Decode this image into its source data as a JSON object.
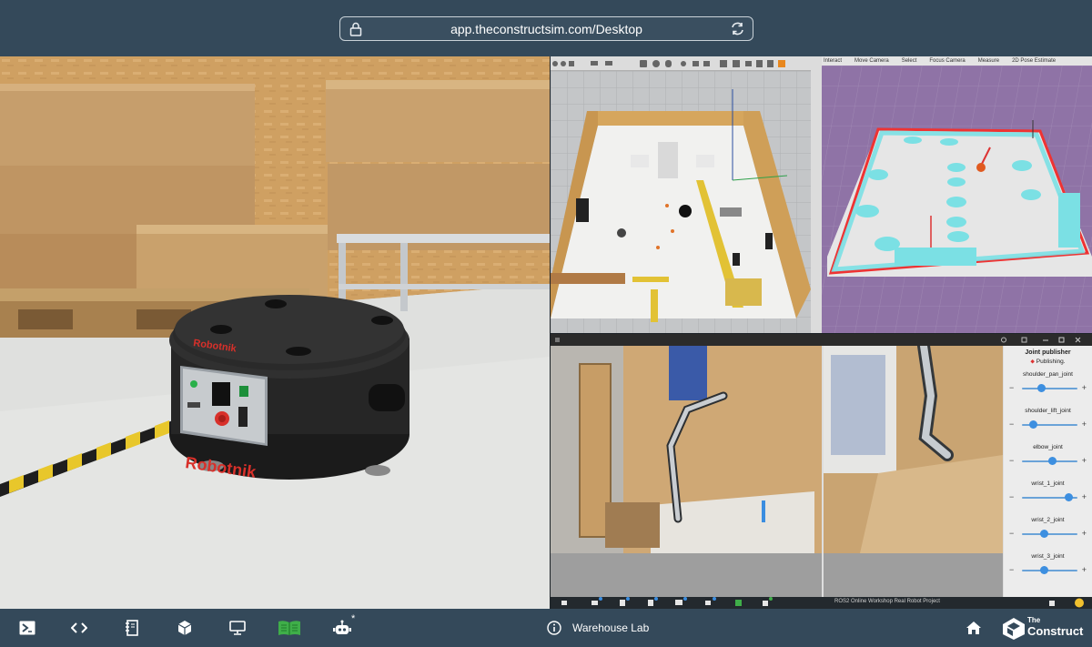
{
  "address_bar": {
    "url": "app.theconstructsim.com/Desktop",
    "lock_icon": "lock-icon",
    "reload_icon": "reload-icon"
  },
  "photo": {
    "robot_brand": "Robotnik",
    "robot_brand_top": "Robotnik"
  },
  "rviz": {
    "tools": [
      "Interact",
      "Move Camera",
      "Select",
      "Focus Camera",
      "Measure",
      "2D Pose Estimate"
    ]
  },
  "joint_publisher": {
    "title": "Joint publisher",
    "status": "Publishing.",
    "joints": [
      {
        "name": "shoulder_pan_joint",
        "value": 0.35
      },
      {
        "name": "shoulder_lift_joint",
        "value": 0.2
      },
      {
        "name": "elbow_joint",
        "value": 0.55
      },
      {
        "name": "wrist_1_joint",
        "value": 0.85
      },
      {
        "name": "wrist_2_joint",
        "value": 0.4
      },
      {
        "name": "wrist_3_joint",
        "value": 0.4
      }
    ]
  },
  "mini_taskbar": {
    "title": "ROS2 Online Workshop Real Robot Project"
  },
  "taskbar": {
    "items": [
      {
        "icon": "terminal-icon"
      },
      {
        "icon": "code-editor-icon"
      },
      {
        "icon": "notebook-icon"
      },
      {
        "icon": "cube-icon"
      },
      {
        "icon": "monitor-icon"
      },
      {
        "icon": "open-book-icon"
      },
      {
        "icon": "robot-icon",
        "badge": "*"
      }
    ],
    "workspace_name": "Warehouse Lab",
    "info_icon": "info-icon",
    "home_icon": "home-icon",
    "brand_small": "The",
    "brand_big": "Construct"
  },
  "colors": {
    "bar_bg": "#34495a",
    "accent_green": "#3fae49",
    "rviz_bg": "#8f73a6",
    "robot_red": "#d8302a"
  }
}
